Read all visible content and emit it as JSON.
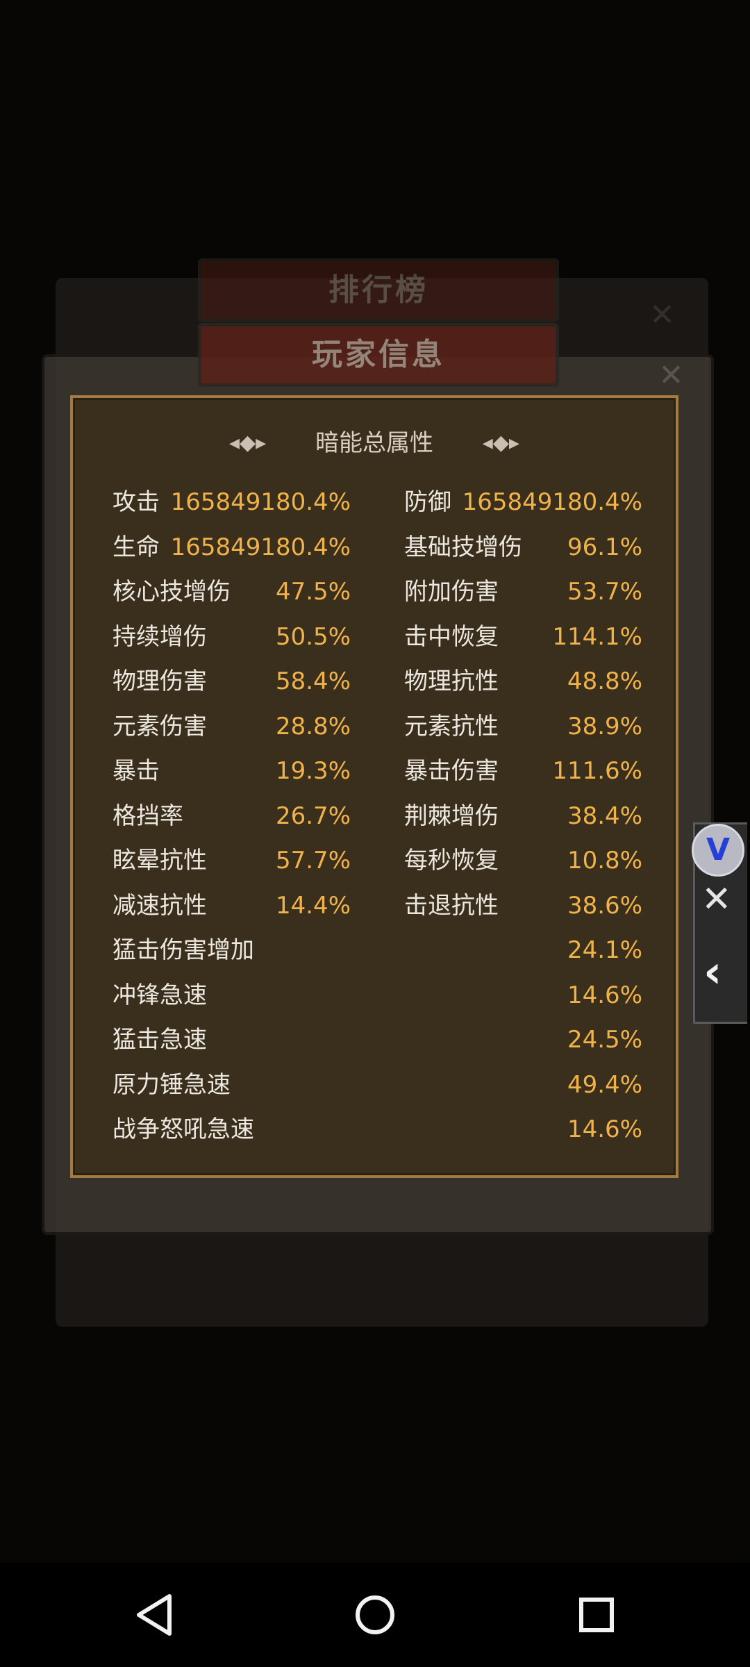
{
  "background": {
    "banner_rank": "排行榜",
    "banner_info": "玩家信息"
  },
  "panel": {
    "title": "暗能总属性",
    "stats_pairs": [
      {
        "l_label": "攻击",
        "l_value": "165849180.4%",
        "r_label": "防御",
        "r_value": "165849180.4%"
      },
      {
        "l_label": "生命",
        "l_value": "165849180.4%",
        "r_label": "基础技增伤",
        "r_value": "96.1%"
      },
      {
        "l_label": "核心技增伤",
        "l_value": "47.5%",
        "r_label": "附加伤害",
        "r_value": "53.7%"
      },
      {
        "l_label": "持续增伤",
        "l_value": "50.5%",
        "r_label": "击中恢复",
        "r_value": "114.1%"
      },
      {
        "l_label": "物理伤害",
        "l_value": "58.4%",
        "r_label": "物理抗性",
        "r_value": "48.8%"
      },
      {
        "l_label": "元素伤害",
        "l_value": "28.8%",
        "r_label": "元素抗性",
        "r_value": "38.9%"
      },
      {
        "l_label": "暴击",
        "l_value": "19.3%",
        "r_label": "暴击伤害",
        "r_value": "111.6%"
      },
      {
        "l_label": "格挡率",
        "l_value": "26.7%",
        "r_label": "荆棘增伤",
        "r_value": "38.4%"
      },
      {
        "l_label": "眩晕抗性",
        "l_value": "57.7%",
        "r_label": "每秒恢复",
        "r_value": "10.8%"
      },
      {
        "l_label": "减速抗性",
        "l_value": "14.4%",
        "r_label": "击退抗性",
        "r_value": "38.6%"
      }
    ],
    "stats_full": [
      {
        "label": "猛击伤害增加",
        "value": "24.1%"
      },
      {
        "label": "冲锋急速",
        "value": "14.6%"
      },
      {
        "label": "猛击急速",
        "value": "24.5%"
      },
      {
        "label": "原力锤急速",
        "value": "49.4%"
      },
      {
        "label": "战争怒吼急速",
        "value": "14.6%"
      }
    ]
  },
  "side_widget": {
    "logo_icon": "v-logo-icon",
    "close_icon": "close-icon",
    "back_icon": "chevron-left-icon"
  },
  "navbar": {
    "back_icon": "nav-back-icon",
    "home_icon": "nav-home-icon",
    "recent_icon": "nav-recent-icon"
  },
  "colors": {
    "value_accent": "#f0b24a",
    "panel_bg": "#3a2e1c",
    "panel_border": "#a47b3c"
  }
}
